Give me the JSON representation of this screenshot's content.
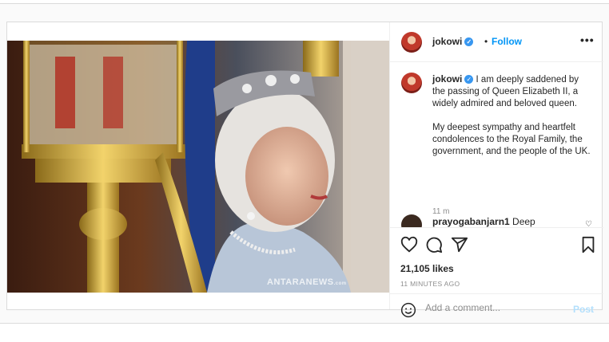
{
  "post": {
    "username": "jokowi",
    "follow_label": "Follow",
    "dot": "•",
    "more_glyph": "•••"
  },
  "caption": {
    "username": "jokowi",
    "paragraph1": "I am deeply saddened by the passing of Queen Elizabeth II, a widely admired and beloved queen.",
    "paragraph2": "My deepest sympathy and heartfelt condolences to the Royal Family, the government, and the people of the UK.",
    "time": "11 m"
  },
  "comment2": {
    "username": "prayogabanjarn1",
    "text": "Deep"
  },
  "actions": {
    "likes": "21,105 likes",
    "posted_ago": "11 MINUTES AGO"
  },
  "add_comment": {
    "placeholder": "Add a comment...",
    "post_label": "Post"
  },
  "media": {
    "watermark": "ANTARANEWS",
    "watermark_suffix": ".com"
  },
  "icons": [
    "verified-badge-icon",
    "more-options-icon",
    "heart-icon",
    "comment-icon",
    "share-icon",
    "bookmark-icon",
    "emoji-icon",
    "small-heart-icon"
  ],
  "colors": {
    "accent": "#0095f6",
    "post_disabled": "#b2dffc",
    "verified": "#3897f0"
  }
}
